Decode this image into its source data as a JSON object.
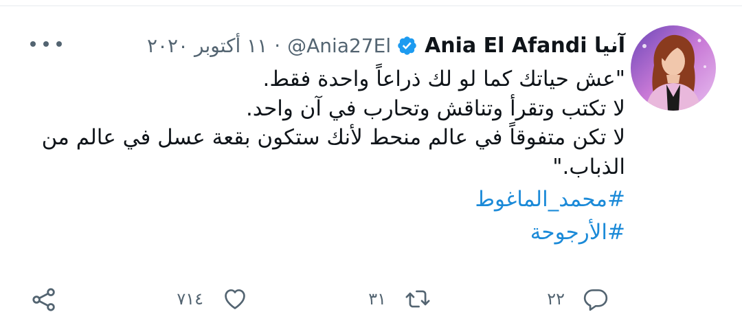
{
  "tweet": {
    "author": {
      "name": "Ania El Afandi آنيا",
      "handle": "@Ania27El",
      "verified": true
    },
    "separator": "·",
    "date": "١١ أكتوبر ٢٠٢٠",
    "text_lines": [
      "\"عش حياتك كما لو لك ذراعاً واحدة فقط.",
      "لا تكتب وتقرأ وتناقش وتحارب في آن واحد.",
      "لا تكن متفوقاً في عالم منحط لأنك ستكون بقعة عسل في عالم من الذباب.\""
    ],
    "hashtags": [
      "#محمد_الماغوط",
      "#الأرجوحة"
    ],
    "counts": {
      "replies": "٢٢",
      "retweets": "٣١",
      "likes": "٧١٤"
    }
  },
  "colors": {
    "accent": "#1b8ad8",
    "verified_badge": "#1d9bf0",
    "secondary_text": "#536471"
  },
  "icons": {
    "more": "more-icon",
    "verified": "verified-badge-icon",
    "reply": "reply-icon",
    "retweet": "retweet-icon",
    "like": "like-icon",
    "share": "share-icon"
  }
}
